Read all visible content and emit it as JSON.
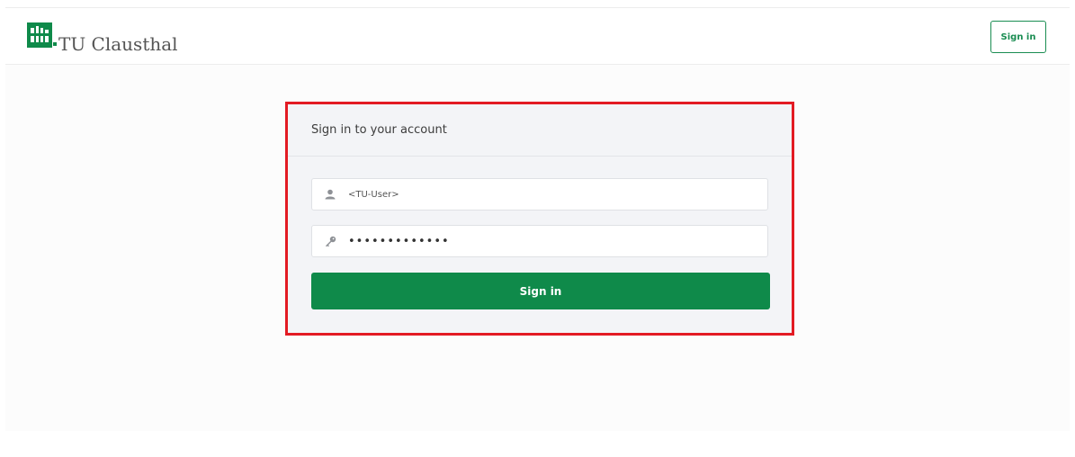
{
  "header": {
    "logo_text": "TU Clausthal",
    "signin_label": "Sign in"
  },
  "login": {
    "title": "Sign in to your account",
    "username_value": "<TU-User>",
    "password_value": "•••••••••••••",
    "submit_label": "Sign in"
  },
  "icons": {
    "user": "user-icon",
    "password": "key-icon"
  },
  "colors": {
    "brand_green": "#0f8a4a",
    "highlight_red": "#e31b23"
  }
}
